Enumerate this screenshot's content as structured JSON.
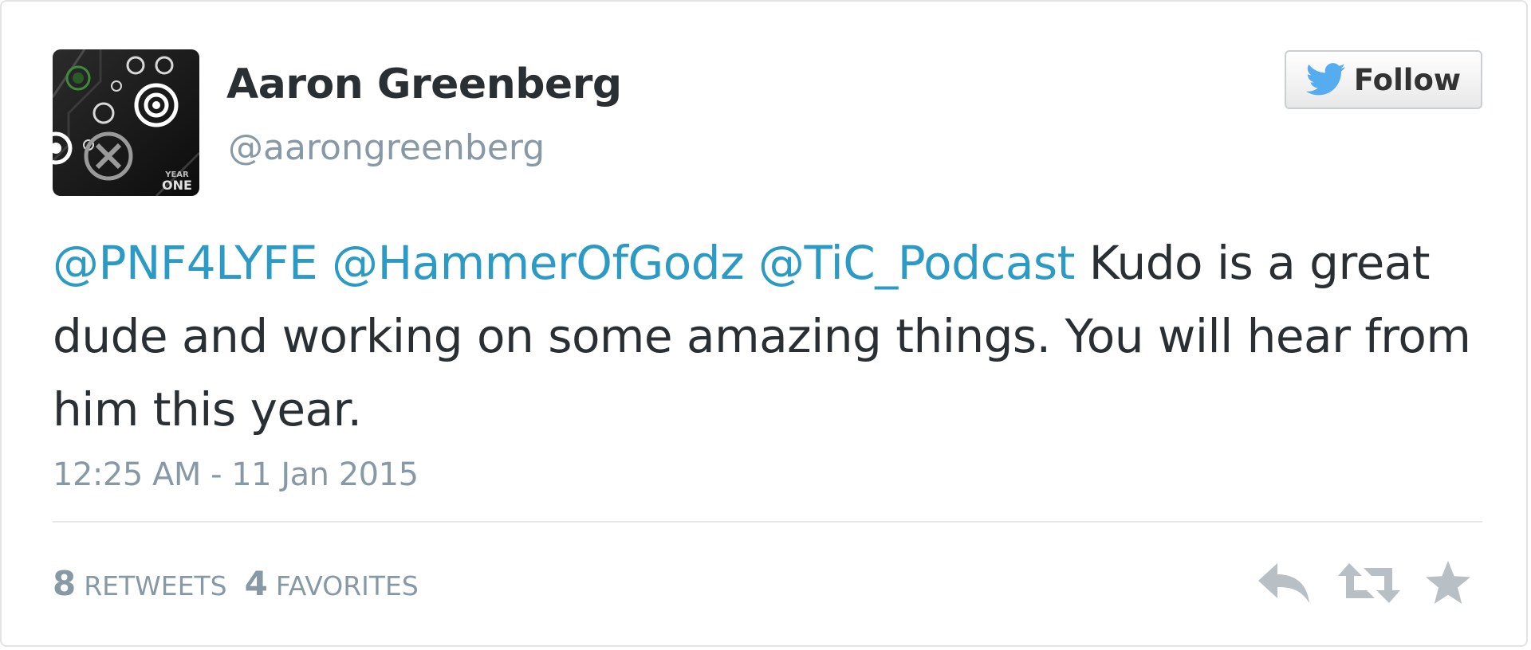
{
  "user": {
    "name": "Aaron Greenberg",
    "handle": "@aarongreenberg",
    "avatar_icon": "controller-avatar-icon"
  },
  "follow": {
    "label": "Follow",
    "icon": "twitter-bird-icon",
    "bird_color": "#55acee"
  },
  "tweet": {
    "mentions": [
      "@PNF4LYFE",
      "@HammerOfGodz",
      "@TiC_Podcast"
    ],
    "text": " Kudo is a great dude and working on some amazing things. You will hear from him this year.",
    "timestamp": "12:25 AM - 11 Jan 2015"
  },
  "stats": {
    "retweets_count": "8",
    "retweets_label": "RETWEETS",
    "favorites_count": "4",
    "favorites_label": "FAVORITES"
  },
  "actions": {
    "reply_icon": "reply-icon",
    "retweet_icon": "retweet-icon",
    "favorite_icon": "star-icon"
  },
  "colors": {
    "mention": "#2b9ac4",
    "text": "#292f33",
    "muted": "#8899a6",
    "icon": "#b8c0c6"
  }
}
